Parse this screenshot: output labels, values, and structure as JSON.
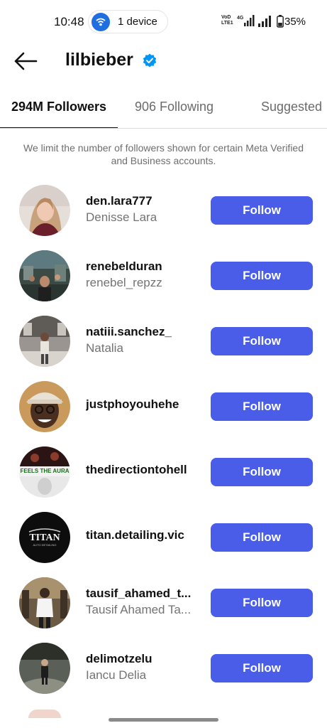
{
  "status_bar": {
    "time": "10:48",
    "device_label": "1 device",
    "volte_line1": "VoD",
    "volte_line2": "LTE1",
    "network": "4G",
    "battery": "35%"
  },
  "header": {
    "title": "lilbieber",
    "verified_color": "#0095f6"
  },
  "tabs": {
    "followers": "294M Followers",
    "following": "906 Following",
    "suggested": "Suggested"
  },
  "notice": "We limit the number of followers shown for certain Meta Verified and Business accounts.",
  "follow_button_color": "#4a5de8",
  "followers": [
    {
      "username": "den.lara777",
      "name": "Denisse Lara",
      "button": "Follow"
    },
    {
      "username": "renebelduran",
      "name": "renebel_repzz",
      "button": "Follow"
    },
    {
      "username": "natiii.sanchez_",
      "name": "Natalia",
      "button": "Follow"
    },
    {
      "username": "justphoyouhehe",
      "name": "",
      "button": "Follow"
    },
    {
      "username": "thedirectiontohell",
      "name": "",
      "button": "Follow",
      "avatar_text": "FEELS THE AURA"
    },
    {
      "username": "titan.detailing.vic",
      "name": "",
      "button": "Follow",
      "avatar_text": "TITAN",
      "avatar_subtext": "AUTO DETAILING"
    },
    {
      "username": "tausif_ahamed_t...",
      "name": "Tausif Ahamed Ta...",
      "button": "Follow"
    },
    {
      "username": "delimotzelu",
      "name": "Iancu Delia",
      "button": "Follow"
    }
  ]
}
